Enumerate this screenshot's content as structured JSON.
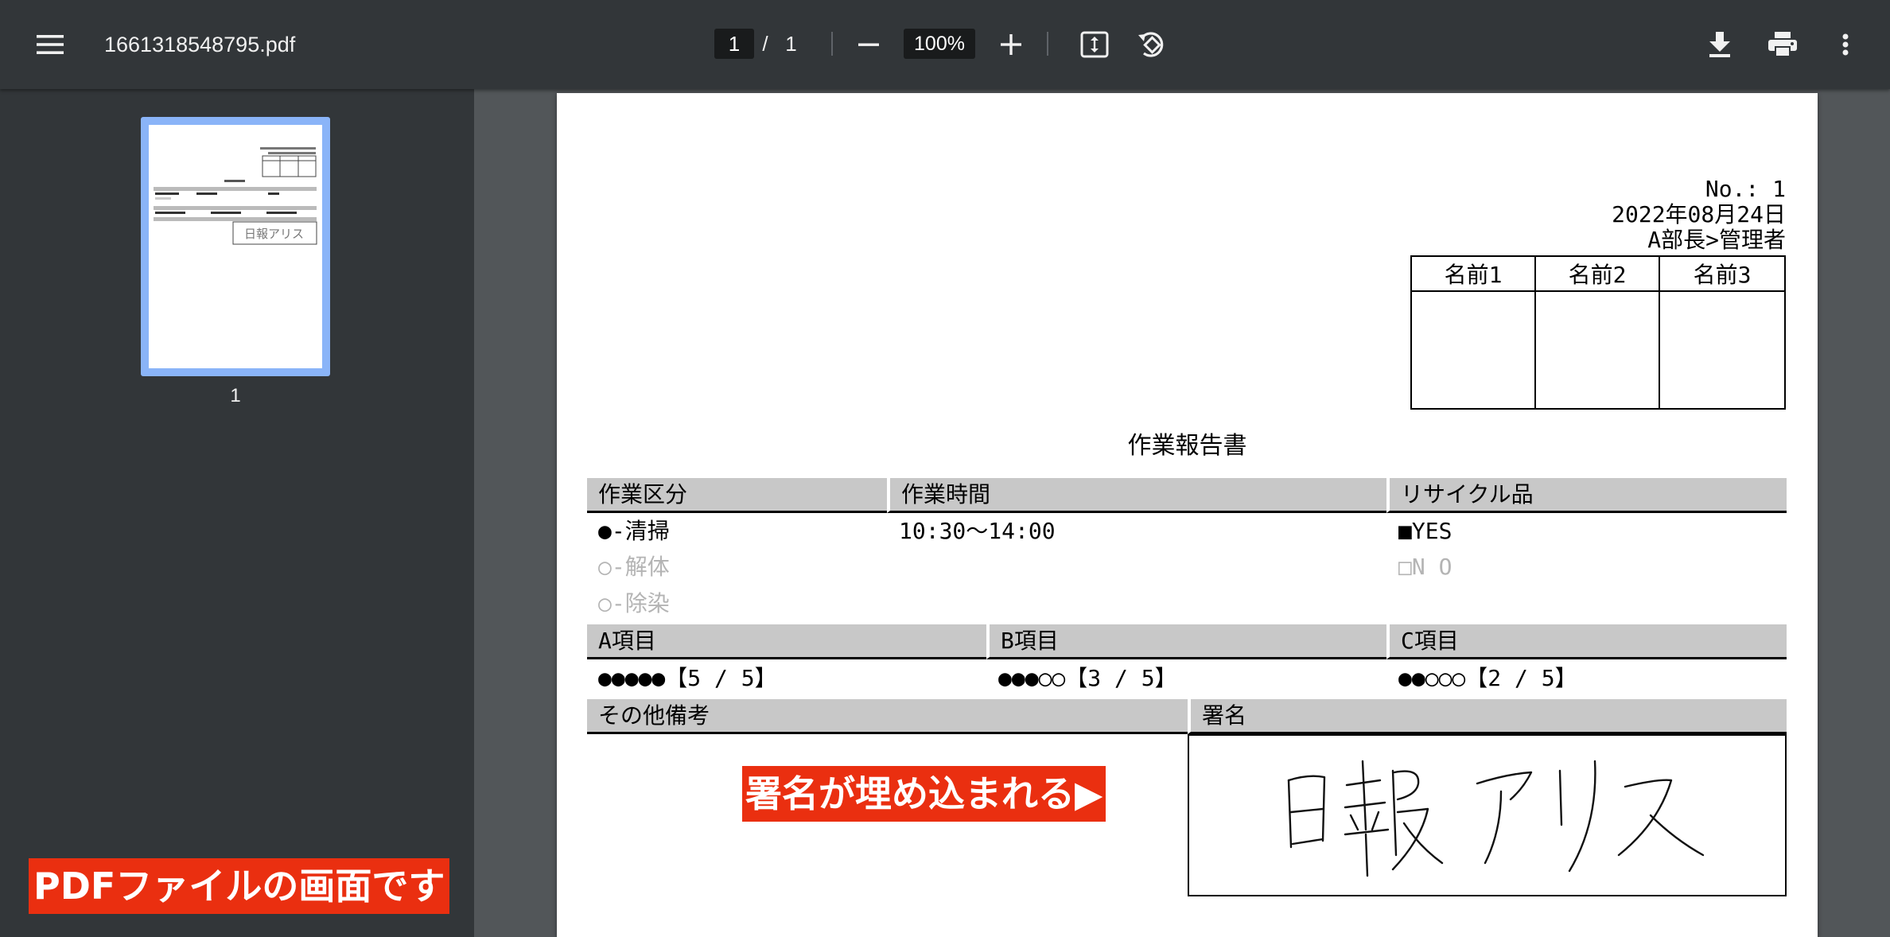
{
  "toolbar": {
    "menu_icon": "menu-icon",
    "filename": "1661318548795.pdf",
    "current_page": "1",
    "page_separator": "/",
    "total_pages": "1",
    "zoom_out_icon": "minus-icon",
    "zoom_level": "100%",
    "zoom_in_icon": "plus-icon",
    "fit_icon": "fit-to-page-icon",
    "rotate_icon": "rotate-icon",
    "download_icon": "download-icon",
    "print_icon": "print-icon",
    "more_icon": "more-vertical-icon"
  },
  "sidebar": {
    "thumbnails": [
      {
        "page_number": "1",
        "selected": true
      }
    ]
  },
  "document": {
    "number_line": "No.: 1",
    "date_line": "2022年08月24日",
    "author_line": "A部長>管理者",
    "approval_headers": [
      "名前1",
      "名前2",
      "名前3"
    ],
    "title": "作業報告書",
    "section1": {
      "work_type_label": "作業区分",
      "work_time_label": "作業時間",
      "recycle_label": "リサイクル品",
      "work_types": [
        {
          "text": "●-清掃",
          "selected": true
        },
        {
          "text": "○-解体",
          "selected": false
        },
        {
          "text": "○-除染",
          "selected": false
        }
      ],
      "work_time": "10:30～14:00",
      "recycle_options": [
        {
          "text": "■YES",
          "selected": true
        },
        {
          "text": "□N O",
          "selected": false
        }
      ]
    },
    "section2": {
      "a_label": "A項目",
      "b_label": "B項目",
      "c_label": "C項目",
      "a_value": "●●●●●【5 / 5】",
      "b_value": "●●●○○【3 / 5】",
      "c_value": "●●○○○【2 / 5】",
      "a_rating": 5,
      "b_rating": 3,
      "c_rating": 2
    },
    "section3": {
      "remarks_label": "その他備考",
      "signature_label": "署名",
      "signature_text": "日報アリス"
    },
    "callout": "署名が埋め込まれる▶"
  },
  "overlay_label": "PDFファイルの画面です",
  "colors": {
    "toolbar_bg": "#323639",
    "viewer_bg": "#525659",
    "thumb_selected": "#8ab4f8",
    "band_grey": "#c8c8c8",
    "callout_red": "#ea2f10"
  }
}
